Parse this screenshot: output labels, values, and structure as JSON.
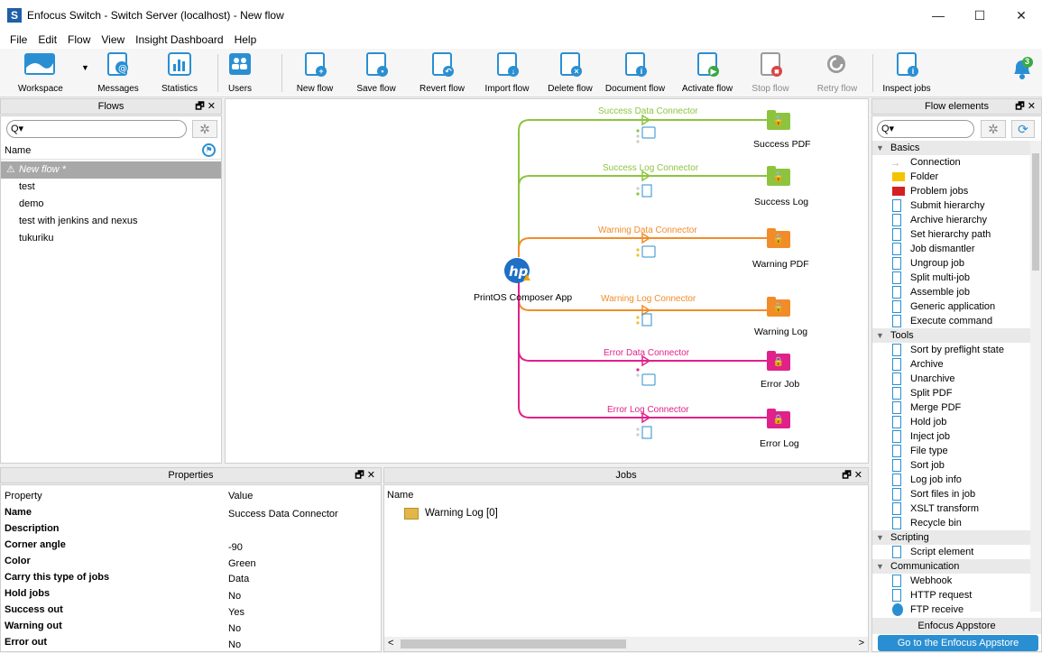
{
  "window": {
    "title": "Enfocus Switch - Switch Server (localhost) - New flow",
    "app_icon": "S",
    "minimize": "—",
    "maximize": "☐",
    "close": "✕"
  },
  "menu": [
    "File",
    "Edit",
    "Flow",
    "View",
    "Insight Dashboard",
    "Help"
  ],
  "toolbar": {
    "workspace": "Workspace",
    "messages": "Messages",
    "statistics": "Statistics",
    "users": "Users",
    "new_flow": "New flow",
    "save_flow": "Save flow",
    "revert_flow": "Revert flow",
    "import_flow": "Import flow",
    "delete_flow": "Delete flow",
    "document_flow": "Document flow",
    "activate_flow": "Activate flow",
    "stop_flow": "Stop flow",
    "retry_flow": "Retry flow",
    "inspect_jobs": "Inspect jobs",
    "notification_count": "3"
  },
  "flows_panel": {
    "title": "Flows",
    "controls": "🗗 ✕",
    "search_glyph": "Q▾",
    "column": "Name",
    "items": [
      {
        "label": "New flow *"
      },
      {
        "label": "test"
      },
      {
        "label": "demo"
      },
      {
        "label": "test with jenkins and nexus"
      },
      {
        "label": "tukuriku"
      }
    ]
  },
  "canvas": {
    "app_label": "PrintOS Composer App",
    "app_logo": "hp",
    "connectors": [
      {
        "label": "Success Data Connector",
        "color": "#8dc43f"
      },
      {
        "label": "Success Log Connector",
        "color": "#8dc43f"
      },
      {
        "label": "Warning Data Connector",
        "color": "#f28c28"
      },
      {
        "label": "Warning Log Connector",
        "color": "#f28c28"
      },
      {
        "label": "Error Data Connector",
        "color": "#e0218a"
      },
      {
        "label": "Error Log Connector",
        "color": "#e0218a"
      }
    ],
    "folders": [
      {
        "label": "Success PDF",
        "color": "#8dc43f"
      },
      {
        "label": "Success Log",
        "color": "#8dc43f"
      },
      {
        "label": "Warning PDF",
        "color": "#f28c28"
      },
      {
        "label": "Warning Log",
        "color": "#f28c28"
      },
      {
        "label": "Error Job",
        "color": "#e0218a"
      },
      {
        "label": "Error Log",
        "color": "#e0218a"
      }
    ]
  },
  "properties_panel": {
    "title": "Properties",
    "controls": "🗗 ✕",
    "col_property": "Property",
    "col_value": "Value",
    "rows": [
      {
        "key": "Name",
        "value": "Success Data Connector"
      },
      {
        "key": "Description",
        "value": ""
      },
      {
        "key": "Corner angle",
        "value": "-90"
      },
      {
        "key": "Color",
        "value": "Green"
      },
      {
        "key": "Carry this type of jobs",
        "value": "Data"
      },
      {
        "key": "Hold jobs",
        "value": "No"
      },
      {
        "key": "Success out",
        "value": "Yes"
      },
      {
        "key": "Warning out",
        "value": "No"
      },
      {
        "key": "Error out",
        "value": "No"
      }
    ]
  },
  "jobs_panel": {
    "title": "Jobs",
    "controls": "🗗 ✕",
    "column": "Name",
    "items": [
      {
        "label": "Warning Log [0]"
      }
    ],
    "scroll_left": "<",
    "scroll_right": ">"
  },
  "elements_panel": {
    "title": "Flow elements",
    "controls": "🗗 ✕",
    "sections": [
      {
        "name": "Basics",
        "items": [
          "Connection",
          "Folder",
          "Problem jobs",
          "Submit hierarchy",
          "Archive hierarchy",
          "Set hierarchy path",
          "Job dismantler",
          "Ungroup job",
          "Split multi-job",
          "Assemble job",
          "Generic application",
          "Execute command"
        ]
      },
      {
        "name": "Tools",
        "items": [
          "Sort by preflight state",
          "Archive",
          "Unarchive",
          "Split PDF",
          "Merge PDF",
          "Hold job",
          "Inject job",
          "File type",
          "Sort job",
          "Log job info",
          "Sort files in job",
          "XSLT transform",
          "Recycle bin"
        ]
      },
      {
        "name": "Scripting",
        "items": [
          "Script element"
        ]
      },
      {
        "name": "Communication",
        "items": [
          "Webhook",
          "HTTP request",
          "FTP receive"
        ]
      }
    ],
    "appstore_title": "Enfocus Appstore",
    "appstore_button": "Go to the Enfocus Appstore"
  }
}
